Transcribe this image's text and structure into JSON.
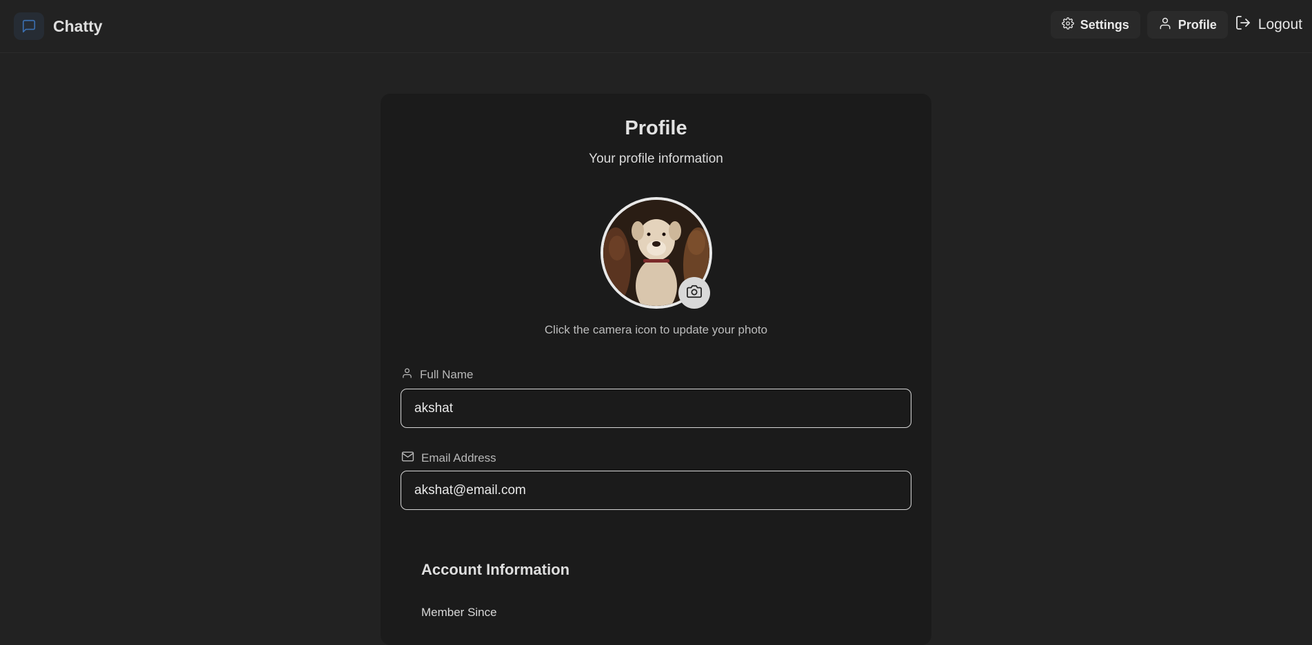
{
  "header": {
    "brand_name": "Chatty",
    "settings_label": "Settings",
    "profile_label": "Profile",
    "logout_label": "Logout",
    "accent_color": "#3b6fb0"
  },
  "profile": {
    "title": "Profile",
    "subtitle": "Your profile information",
    "photo_hint": "Click the camera icon to update your photo",
    "full_name": {
      "label": "Full Name",
      "value": "akshat"
    },
    "email": {
      "label": "Email Address",
      "value": "akshat@email.com"
    }
  },
  "account": {
    "title": "Account Information",
    "member_since_label": "Member Since"
  }
}
